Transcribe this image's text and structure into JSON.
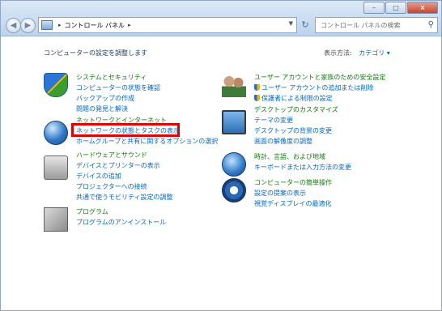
{
  "window": {
    "controls": [
      "–",
      "□",
      "×"
    ]
  },
  "nav": {
    "back": "◀",
    "forward": "▶",
    "address": {
      "separator": "▸",
      "crumb": "コントロール パネル",
      "trailing": "▸"
    },
    "refresh": "↻",
    "search_placeholder": "コントロール パネルの検索"
  },
  "header": {
    "title": "コンピューターの設定を調整します",
    "view_by_label": "表示方法:",
    "view_by_value": "カテゴリ ▾"
  },
  "left_categories": [
    {
      "title": "システムとセキュリティ",
      "links": [
        "コンピューターの状態を確認",
        "バックアップの作成",
        "問題の発見と解決"
      ]
    },
    {
      "title": "ネットワークとインターネット",
      "links": [
        "ネットワークの状態とタスクの表示",
        "ホームグループと共有に関するオプションの選択"
      ]
    },
    {
      "title": "ハードウェアとサウンド",
      "links": [
        "デバイスとプリンターの表示",
        "デバイスの追加",
        "プロジェクターへの接続",
        "共通で使うモビリティ設定の調整"
      ]
    },
    {
      "title": "プログラム",
      "links": [
        "プログラムのアンインストール"
      ]
    }
  ],
  "right_categories": [
    {
      "title": "ユーザー アカウントと家族のための安全設定",
      "links": [
        "ユーザー アカウントの追加または削除",
        "保護者による制限の設定"
      ]
    },
    {
      "title": "デスクトップのカスタマイズ",
      "links": [
        "テーマの変更",
        "デスクトップの背景の変更",
        "画面の解像度の調整"
      ]
    },
    {
      "title": "時計、言語、および地域",
      "links": [
        "キーボードまたは入力方法の変更"
      ]
    },
    {
      "title": "コンピューターの簡単操作",
      "links": [
        "設定の提案の表示",
        "視覚ディスプレイの最適化"
      ]
    }
  ],
  "highlight_color": "#e00000"
}
